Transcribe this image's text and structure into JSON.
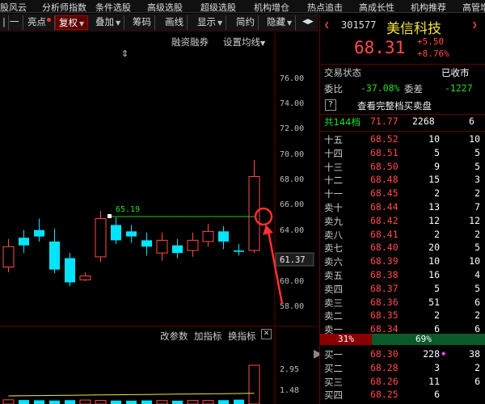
{
  "top_menu": [
    "股风云",
    "分析师指数",
    "条件选股",
    "高级选股",
    "超级选股",
    "机构增仓",
    "热点追击",
    "高成长性",
    "机构推荐",
    "高管增"
  ],
  "toolbar": {
    "lock": "|",
    "minus": "一",
    "highlight": "亮点",
    "fuquan": "复权",
    "overlay": "叠加",
    "chips": "筹码",
    "draw": "画线",
    "display": "显示",
    "brief": "简约",
    "hide": "隐藏",
    "arrows": "◀▶"
  },
  "chart": {
    "margin_label": "融资融券",
    "ma_setting": "设置均线",
    "ma_setting_caret": "▼",
    "updown_icon": "⇕",
    "price_marker": "65.19",
    "current_price_tag": "61.37",
    "y_axis": [
      "76.00",
      "74.00",
      "72.00",
      "70.00",
      "68.00",
      "66.00",
      "64.00",
      "62.00",
      "60.00",
      "58.00"
    ],
    "candles": [
      {
        "o": 61.2,
        "c": 62.8,
        "h": 63.4,
        "l": 60.8,
        "up": true
      },
      {
        "o": 63.5,
        "c": 62.9,
        "h": 64.1,
        "l": 62.3,
        "up": false
      },
      {
        "o": 64.1,
        "c": 63.6,
        "h": 65.0,
        "l": 63.2,
        "up": false
      },
      {
        "o": 63.2,
        "c": 61.0,
        "h": 64.2,
        "l": 60.7,
        "up": false
      },
      {
        "o": 61.9,
        "c": 60.0,
        "h": 62.3,
        "l": 59.7,
        "up": false
      },
      {
        "o": 60.2,
        "c": 60.5,
        "h": 60.8,
        "l": 60.1,
        "up": true
      },
      {
        "o": 62.0,
        "c": 65.0,
        "h": 65.6,
        "l": 61.6,
        "up": true
      },
      {
        "o": 64.5,
        "c": 63.3,
        "h": 65.1,
        "l": 63.0,
        "up": false
      },
      {
        "o": 64.0,
        "c": 63.6,
        "h": 64.5,
        "l": 63.1,
        "up": false
      },
      {
        "o": 63.3,
        "c": 62.8,
        "h": 63.9,
        "l": 62.1,
        "up": false
      },
      {
        "o": 62.3,
        "c": 63.3,
        "h": 63.9,
        "l": 61.7,
        "up": true
      },
      {
        "o": 62.9,
        "c": 62.3,
        "h": 63.4,
        "l": 61.9,
        "up": false
      },
      {
        "o": 62.5,
        "c": 63.3,
        "h": 63.9,
        "l": 62.0,
        "up": true
      },
      {
        "o": 63.2,
        "c": 64.0,
        "h": 64.6,
        "l": 62.8,
        "up": true
      },
      {
        "o": 64.0,
        "c": 63.2,
        "h": 64.4,
        "l": 62.6,
        "up": false
      },
      {
        "o": 62.4,
        "c": 62.5,
        "h": 63.0,
        "l": 62.1,
        "up": false
      },
      {
        "o": 62.5,
        "c": 68.3,
        "h": 69.6,
        "l": 62.3,
        "up": true
      }
    ],
    "sub_buttons": {
      "change_param": "改参数",
      "add_indicator": "加指标",
      "swap_indicator": "换指标",
      "close": "✕"
    },
    "sub_axis": [
      "2.95",
      "1.48"
    ],
    "volumes": [
      0.32,
      0.3,
      0.28,
      0.26,
      0.29,
      0.3,
      0.27,
      0.26,
      0.25,
      0.27,
      0.26,
      0.25,
      0.27,
      0.27,
      0.29,
      0.33,
      2.95
    ],
    "accent_green": "#22dd22",
    "accent_red": "#ff4a4a"
  },
  "quote": {
    "code": "301577",
    "name": "美信科技",
    "price": "68.31",
    "change": "+5.50",
    "change_pct": "+8.76%",
    "status_label": "交易状态",
    "status_value": "已收市",
    "weibi_label": "委比",
    "weibi_value": "-37.08%",
    "weicha_label": "委差",
    "weicha_value": "-1227",
    "full_book_icon": "?",
    "full_book": "查看完整档买卖盘",
    "levels_label": "共144档",
    "levels_price": "71.77",
    "levels_volume": "2268",
    "levels_count": "6",
    "sells": [
      {
        "label": "十五",
        "price": "68.52",
        "vol": "10",
        "cnt": "10"
      },
      {
        "label": "十四",
        "price": "68.51",
        "vol": "5",
        "cnt": "5"
      },
      {
        "label": "十三",
        "price": "68.50",
        "vol": "9",
        "cnt": "5"
      },
      {
        "label": "十二",
        "price": "68.48",
        "vol": "15",
        "cnt": "3"
      },
      {
        "label": "十一",
        "price": "68.45",
        "vol": "2",
        "cnt": "2"
      },
      {
        "label": "卖十",
        "price": "68.44",
        "vol": "13",
        "cnt": "7"
      },
      {
        "label": "卖九",
        "price": "68.42",
        "vol": "12",
        "cnt": "12"
      },
      {
        "label": "卖八",
        "price": "68.41",
        "vol": "2",
        "cnt": "2"
      },
      {
        "label": "卖七",
        "price": "68.40",
        "vol": "20",
        "cnt": "5"
      },
      {
        "label": "卖六",
        "price": "68.39",
        "vol": "10",
        "cnt": "10"
      },
      {
        "label": "卖五",
        "price": "68.38",
        "vol": "16",
        "cnt": "4"
      },
      {
        "label": "卖四",
        "price": "68.37",
        "vol": "5",
        "cnt": "5"
      },
      {
        "label": "卖三",
        "price": "68.36",
        "vol": "51",
        "cnt": "6"
      },
      {
        "label": "卖二",
        "price": "68.35",
        "vol": "2",
        "cnt": "2"
      },
      {
        "label": "卖一",
        "price": "68.34",
        "vol": "6",
        "cnt": "6"
      }
    ],
    "ratio_sell": "31%",
    "ratio_buy": "69%",
    "buys": [
      {
        "label": "买一",
        "price": "68.30",
        "vol": "228",
        "cnt": "38",
        "mark": "◆"
      },
      {
        "label": "买二",
        "price": "68.28",
        "vol": "3",
        "cnt": "2",
        "mark": ""
      },
      {
        "label": "买三",
        "price": "68.26",
        "vol": "11",
        "cnt": "6",
        "mark": ""
      },
      {
        "label": "买四",
        "price": "68.25",
        "vol": "6",
        "cnt": "",
        "mark": ""
      }
    ]
  }
}
